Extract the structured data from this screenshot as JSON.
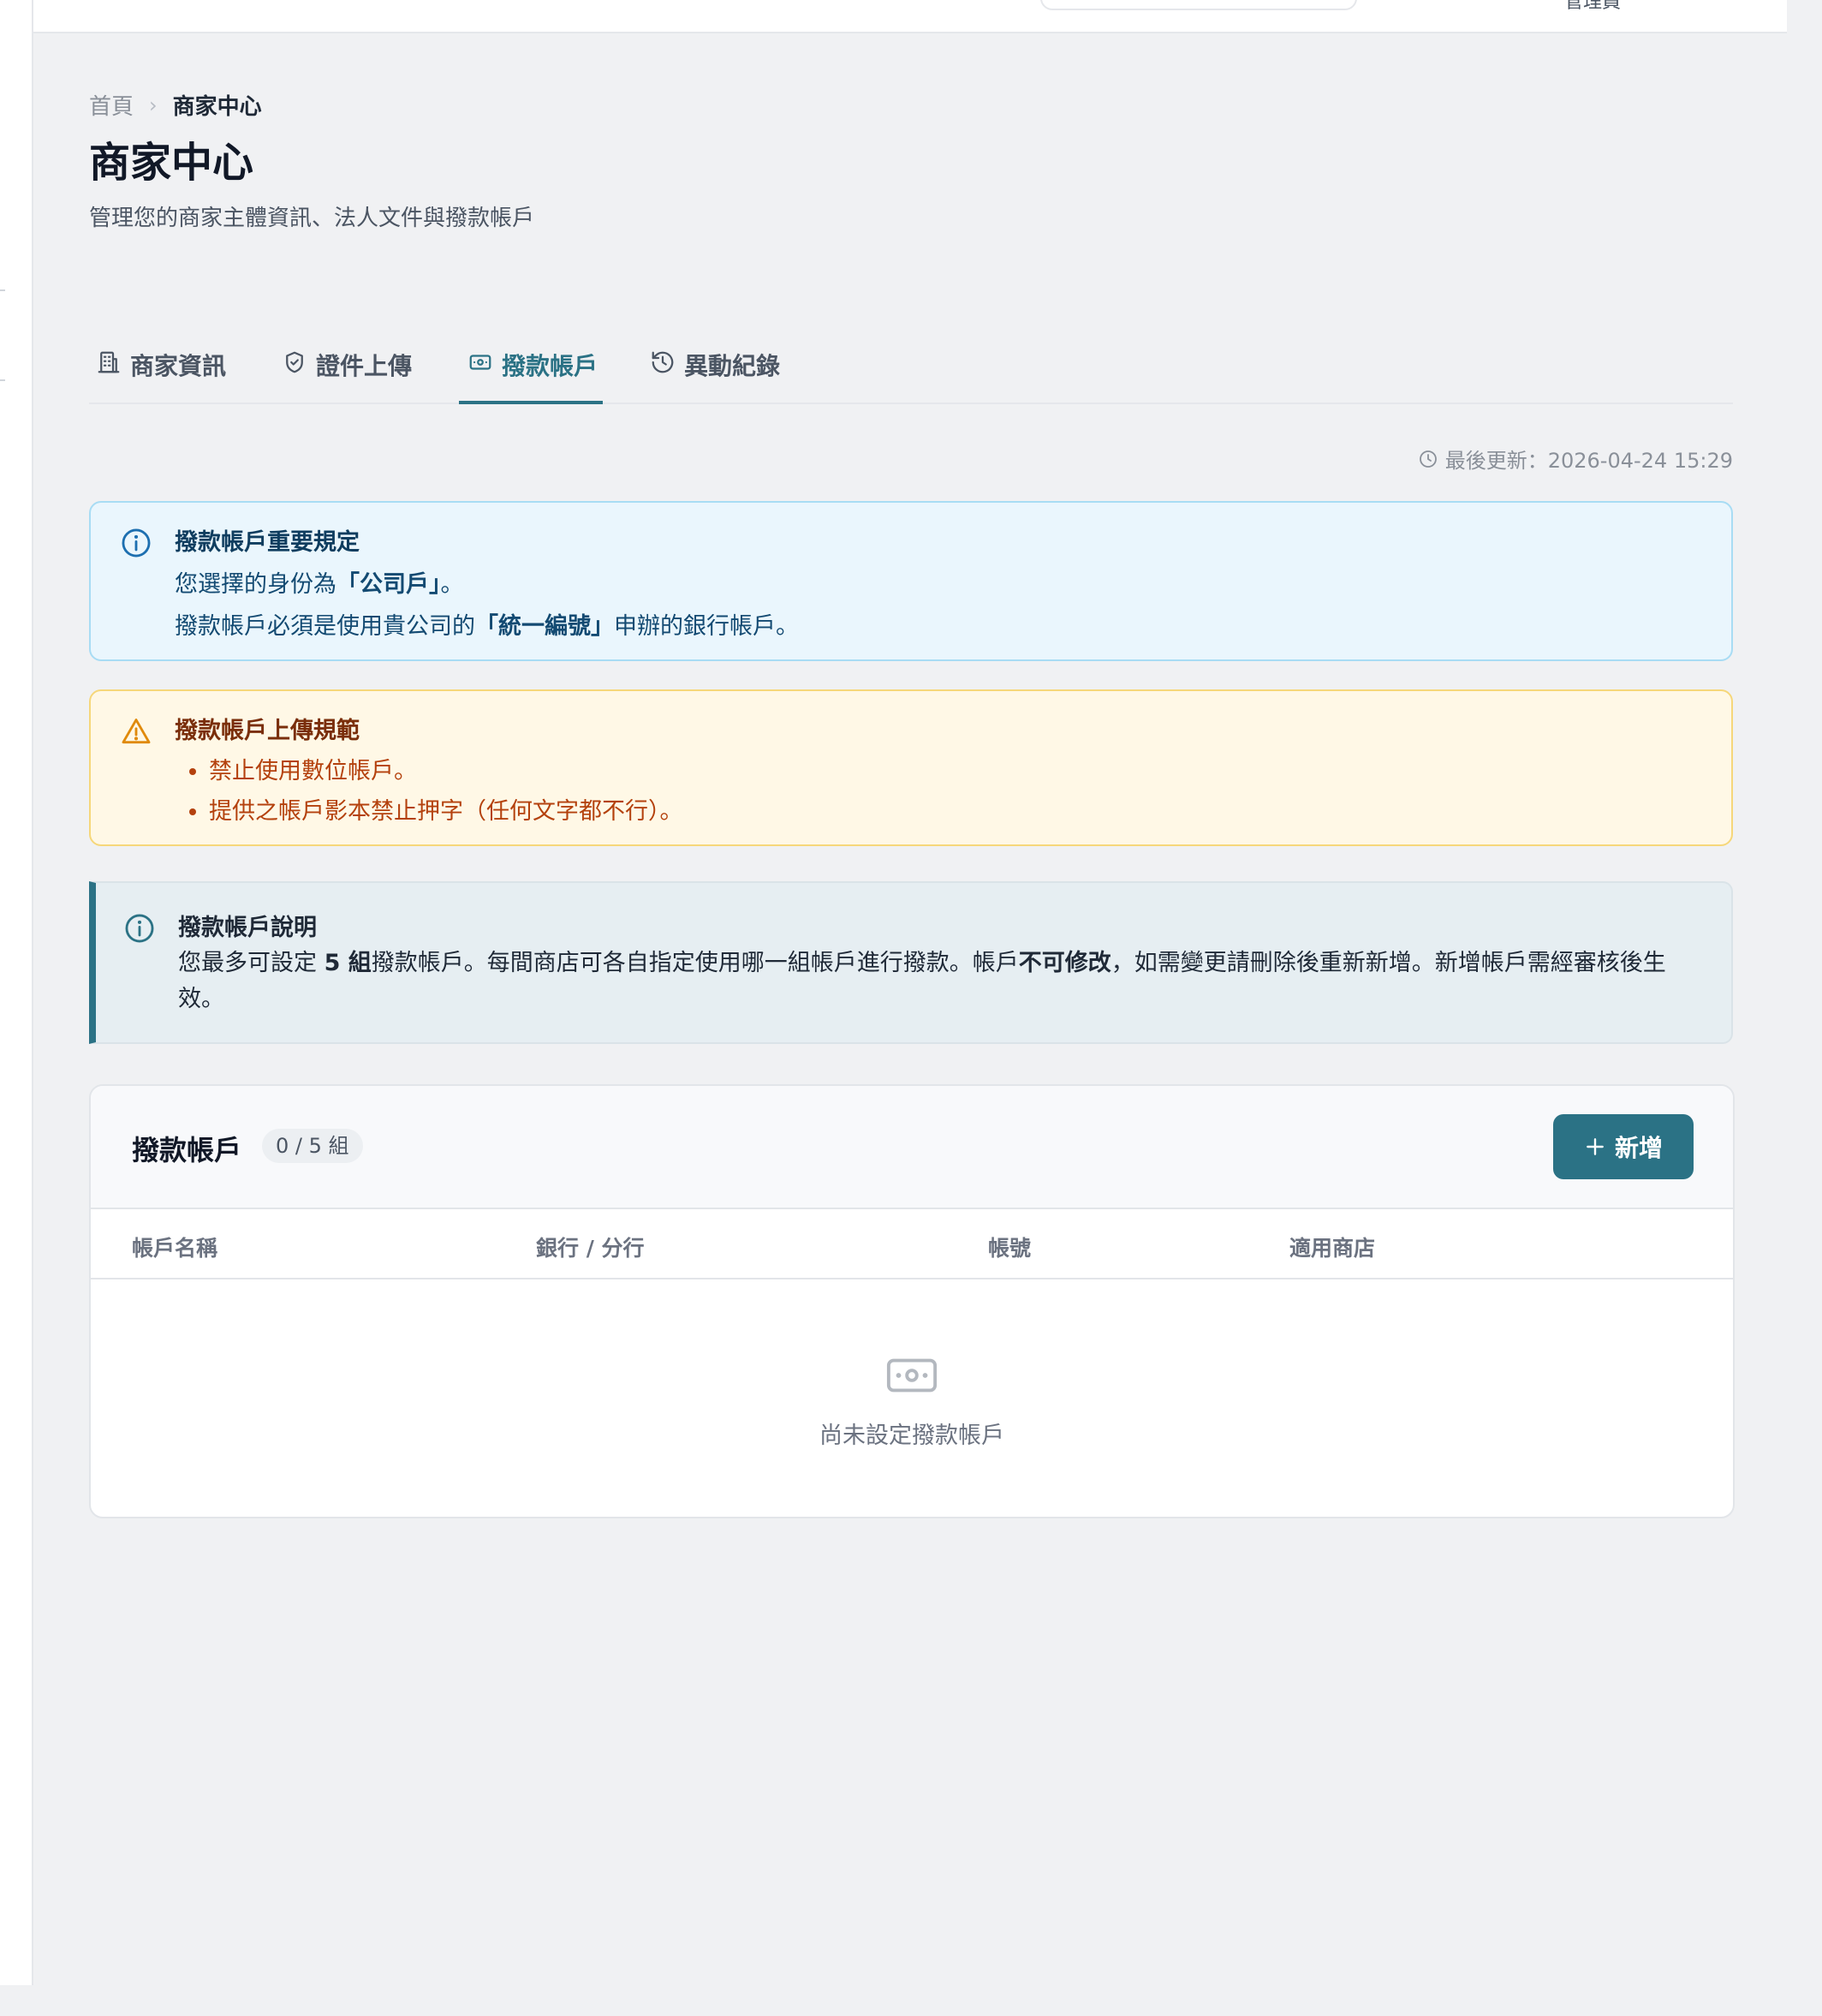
{
  "topbar": {
    "user_label": "管理員"
  },
  "breadcrumb": {
    "home": "首頁",
    "separator": "›",
    "current": "商家中心"
  },
  "page": {
    "title": "商家中心",
    "subtitle": "管理您的商家主體資訊、法人文件與撥款帳戶"
  },
  "tabs": [
    {
      "label": "商家資訊",
      "icon": "building-icon",
      "active": false
    },
    {
      "label": "證件上傳",
      "icon": "shield-check-icon",
      "active": false
    },
    {
      "label": "撥款帳戶",
      "icon": "banknote-icon",
      "active": true
    },
    {
      "label": "異動紀錄",
      "icon": "history-icon",
      "active": false
    }
  ],
  "last_updated": "最後更新：2026-04-24 15:29",
  "info_alert": {
    "title": "撥款帳戶重要規定",
    "line1_prefix": "您選擇的身份為",
    "line1_bold": "「公司戶」",
    "line1_suffix": "。",
    "line2_prefix": "撥款帳戶必須是使用貴公司的",
    "line2_bold": "「統一編號」",
    "line2_suffix": "申辦的銀行帳戶。"
  },
  "warn_alert": {
    "title": "撥款帳戶上傳規範",
    "items": [
      "禁止使用數位帳戶。",
      "提供之帳戶影本禁止押字（任何文字都不行）。"
    ]
  },
  "note_alert": {
    "title": "撥款帳戶說明",
    "part1": "您最多可設定 ",
    "bold1": "5 組",
    "part2": "撥款帳戶。每間商店可各自指定使用哪一組帳戶進行撥款。帳戶",
    "bold2": "不可修改",
    "part3": "，如需變更請刪除後重新新增。新增帳戶需經審核後生效。"
  },
  "accounts_card": {
    "title": "撥款帳戶",
    "count_badge": "0 / 5 組",
    "add_label": "新增",
    "columns": [
      "帳戶名稱",
      "銀行 / 分行",
      "帳號",
      "適用商店"
    ],
    "empty_text": "尚未設定撥款帳戶"
  },
  "colors": {
    "accent": "#2b7285",
    "info_bg": "#eaf6fd",
    "warn_bg": "#fff8e6",
    "note_bg": "#e6eef2"
  }
}
